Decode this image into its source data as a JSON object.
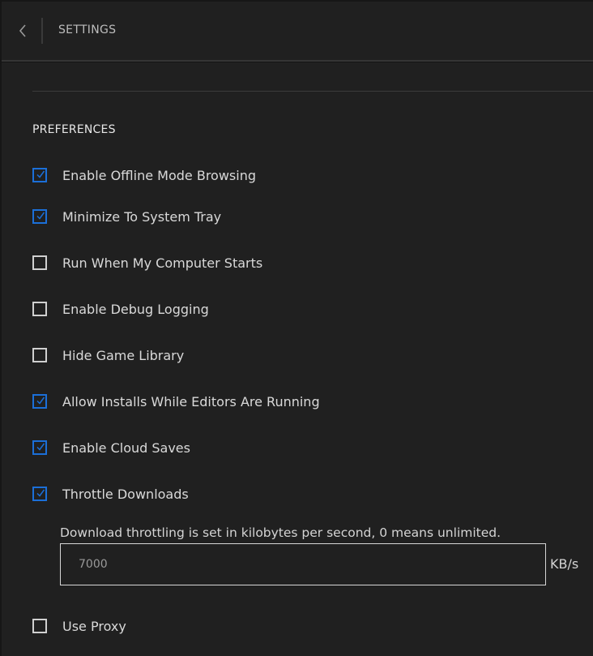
{
  "header": {
    "title": "SETTINGS",
    "back_icon": "chevron-left-icon"
  },
  "section": {
    "title": "PREFERENCES"
  },
  "colors": {
    "accent": "#1b6fd8",
    "background": "#202020",
    "text": "#d9d9d9"
  },
  "options": [
    {
      "label": "Enable Offline Mode Browsing",
      "checked": true
    },
    {
      "label": "Minimize To System Tray",
      "checked": true
    },
    {
      "label": "Run When My Computer Starts",
      "checked": false
    },
    {
      "label": "Enable Debug Logging",
      "checked": false
    },
    {
      "label": "Hide Game Library",
      "checked": false
    },
    {
      "label": "Allow Installs While Editors Are Running",
      "checked": true
    },
    {
      "label": "Enable Cloud Saves",
      "checked": true
    },
    {
      "label": "Throttle Downloads",
      "checked": true
    },
    {
      "label": "Use Proxy",
      "checked": false
    }
  ],
  "throttle": {
    "note": "Download throttling is set in kilobytes per second, 0 means unlimited.",
    "value": "7000",
    "unit": "KB/s"
  }
}
